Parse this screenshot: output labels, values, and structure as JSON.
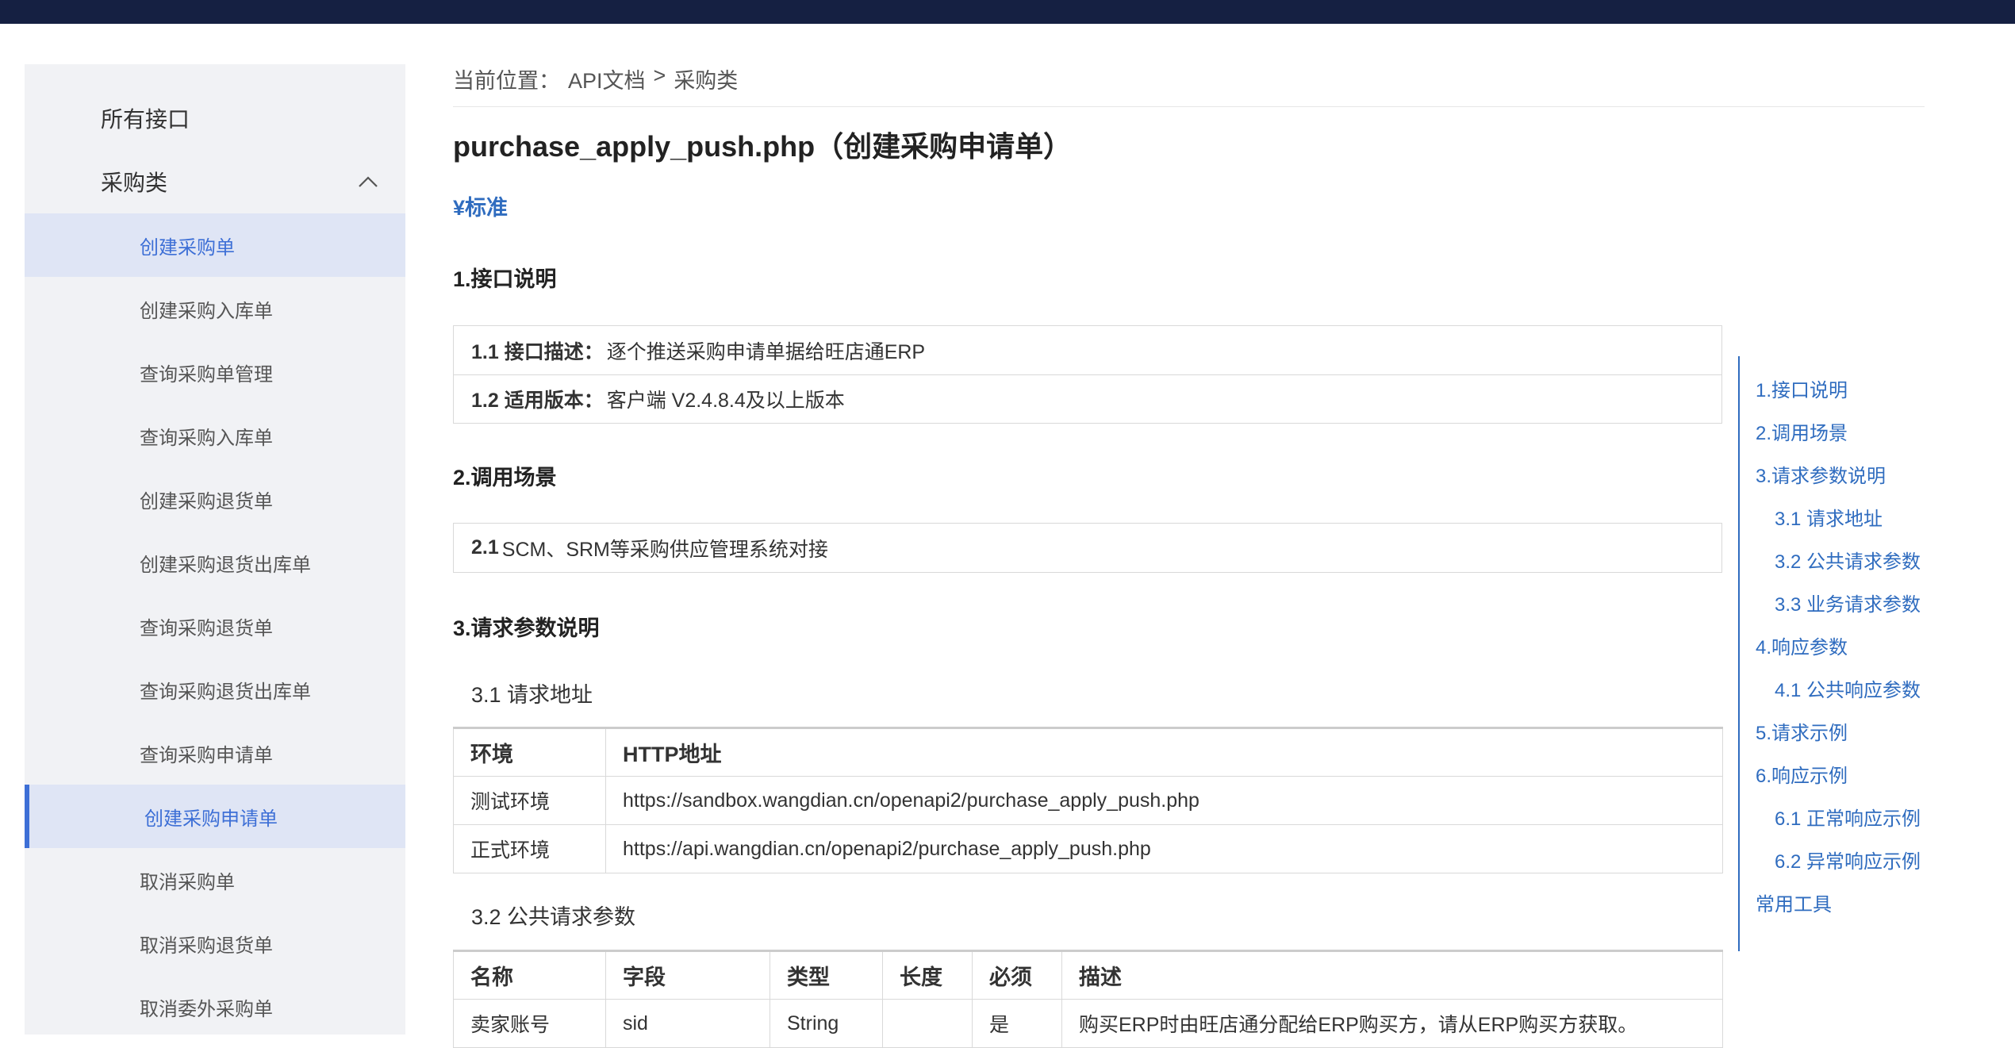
{
  "colors": {
    "topbar": "#152042",
    "accent": "#3d6fd6",
    "link": "#2f6cbf",
    "sidebar_bg": "#f1f2f5",
    "sidebar_active": "#dfe5f5"
  },
  "sidebar": {
    "all_apis": "所有接口",
    "category": "采购类",
    "category_icon": "chevron-up-icon",
    "items": [
      "创建采购单",
      "创建采购入库单",
      "查询采购单管理",
      "查询采购入库单",
      "创建采购退货单",
      "创建采购退货出库单",
      "查询采购退货单",
      "查询采购退货出库单",
      "查询采购申请单",
      "创建采购申请单",
      "取消采购单",
      "取消采购退货单",
      "取消委外采购单"
    ]
  },
  "breadcrumb": {
    "label": "当前位置：",
    "root": "API文档",
    "separator": ">",
    "current": "采购类"
  },
  "page": {
    "title": "purchase_apply_push.php（创建采购申请单）",
    "tag": "¥标准"
  },
  "sections": {
    "s1": {
      "heading": "1.接口说明",
      "rows": [
        {
          "key": "1.1 接口描述：",
          "value": "逐个推送采购申请单据给旺店通ERP"
        },
        {
          "key": "1.2 适用版本：",
          "value": "客户端 V2.4.8.4及以上版本"
        }
      ]
    },
    "s2": {
      "heading": "2.调用场景",
      "rows": [
        {
          "key": "2.1",
          "value": "SCM、SRM等采购供应管理系统对接"
        }
      ]
    },
    "s3": {
      "heading": "3.请求参数说明",
      "sub1": {
        "heading": "3.1 请求地址",
        "columns": [
          "环境",
          "HTTP地址"
        ],
        "rows": [
          [
            "测试环境",
            "https://sandbox.wangdian.cn/openapi2/purchase_apply_push.php"
          ],
          [
            "正式环境",
            "https://api.wangdian.cn/openapi2/purchase_apply_push.php"
          ]
        ]
      },
      "sub2": {
        "heading": "3.2 公共请求参数",
        "columns": [
          "名称",
          "字段",
          "类型",
          "长度",
          "必须",
          "描述"
        ],
        "rows": [
          [
            "卖家账号",
            "sid",
            "String",
            "",
            "是",
            "购买ERP时由旺店通分配给ERP购买方，请从ERP购买方获取。"
          ]
        ]
      }
    }
  },
  "toc": [
    "1.接口说明",
    "2.调用场景",
    "3.请求参数说明",
    "3.1 请求地址",
    "3.2 公共请求参数",
    "3.3 业务请求参数",
    "4.响应参数",
    "4.1 公共响应参数",
    "5.请求示例",
    "6.响应示例",
    "6.1 正常响应示例",
    "6.2 异常响应示例",
    "常用工具"
  ]
}
